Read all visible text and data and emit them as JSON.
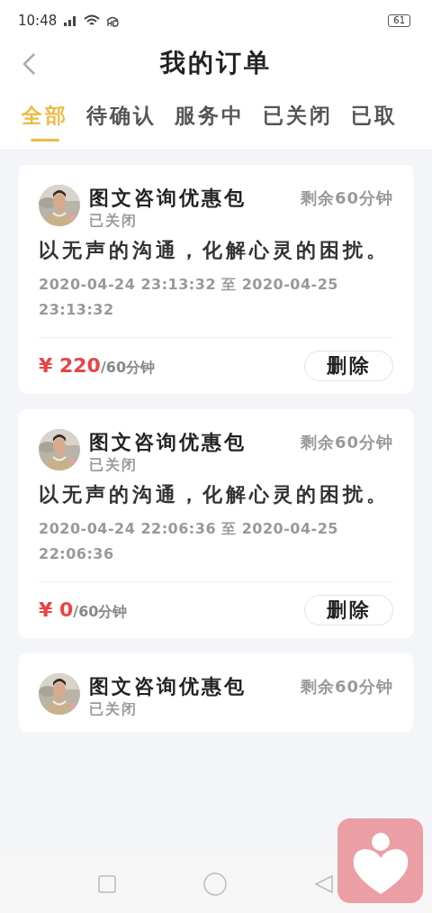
{
  "status_bar": {
    "time": "10:48",
    "battery": "61"
  },
  "header": {
    "title": "我的订单"
  },
  "tabs": [
    {
      "label": "全部",
      "selected": true
    },
    {
      "label": "待确认",
      "selected": false
    },
    {
      "label": "服务中",
      "selected": false
    },
    {
      "label": "已关闭",
      "selected": false
    },
    {
      "label": "已取",
      "selected": false
    }
  ],
  "orders": [
    {
      "title": "图文咨询优惠包",
      "remaining": "剩余60分钟",
      "status": "已关闭",
      "description": "以无声的沟通，化解心灵的困扰。",
      "period": "2020-04-24 23:13:32 至 2020-04-25 23:13:32",
      "currency": "¥",
      "price": "220",
      "unit": "/60分钟",
      "action": "删除"
    },
    {
      "title": "图文咨询优惠包",
      "remaining": "剩余60分钟",
      "status": "已关闭",
      "description": "以无声的沟通，化解心灵的困扰。",
      "period": "2020-04-24 22:06:36 至 2020-04-25 22:06:36",
      "currency": "¥",
      "price": "0",
      "unit": "/60分钟",
      "action": "删除"
    },
    {
      "title": "图文咨询优惠包",
      "remaining": "剩余60分钟",
      "status": "已关闭"
    }
  ]
}
